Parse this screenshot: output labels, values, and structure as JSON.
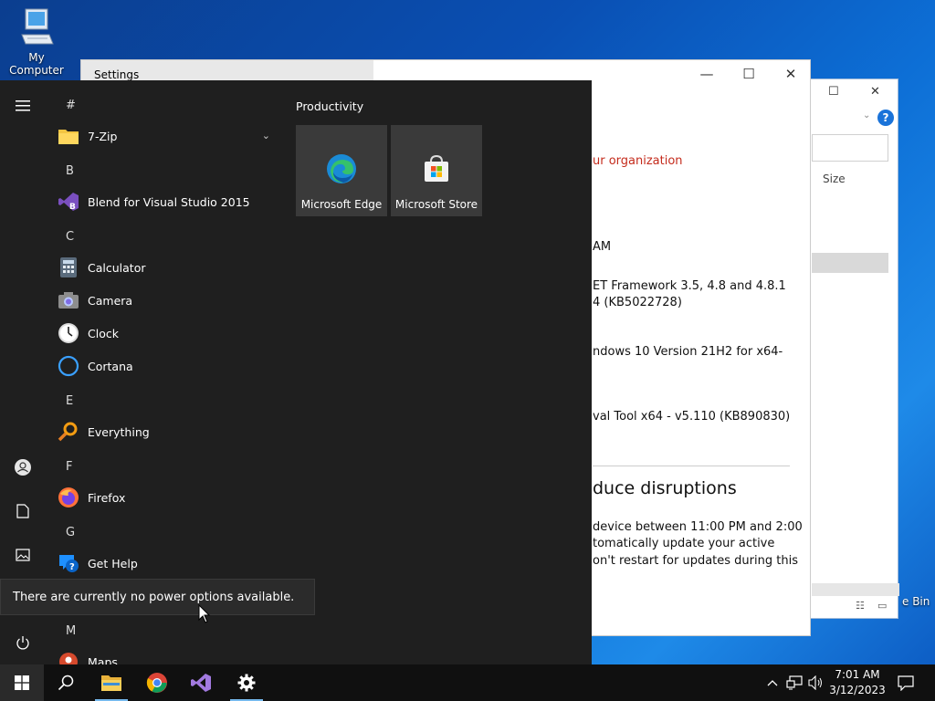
{
  "desktop": {
    "my_computer_label": "My Computer",
    "recycle_bin_label": "e Bin"
  },
  "explorer": {
    "size_col": "Size",
    "help": "?"
  },
  "settings": {
    "title": "Settings",
    "lines": {
      "org": "ur organization",
      "time": "AM",
      "net1": "ET Framework 3.5, 4.8 and 4.8.1",
      "net2": "4 (KB5022728)",
      "win1": "ndows 10 Version 21H2 for x64-",
      "mrt": "val Tool x64 - v5.110 (KB890830)",
      "heading": "duce disruptions",
      "p1": "device between 11:00 PM and 2:00",
      "p2": "tomatically update your active",
      "p3": "on't restart for updates during this"
    }
  },
  "start_menu": {
    "letters": {
      "hash": "#",
      "b": "B",
      "c": "C",
      "e": "E",
      "f": "F",
      "g": "G",
      "m": "M"
    },
    "apps": {
      "zip": "7-Zip",
      "blend": "Blend for Visual Studio 2015",
      "calculator": "Calculator",
      "camera": "Camera",
      "clock": "Clock",
      "cortana": "Cortana",
      "everything": "Everything",
      "firefox": "Firefox",
      "gethelp": "Get Help",
      "maps": "Maps"
    },
    "group_title": "Productivity",
    "tiles": {
      "edge": "Microsoft Edge",
      "store": "Microsoft Store"
    },
    "tooltip": "There are currently no power options available."
  },
  "taskbar": {
    "clock_time": "7:01 AM",
    "clock_date": "3/12/2023"
  },
  "colors": {
    "accent": "#0078d7",
    "start_bg": "#1f1f1f",
    "tile_bg": "#3a3a3a",
    "alert_red": "#c42b1c"
  }
}
